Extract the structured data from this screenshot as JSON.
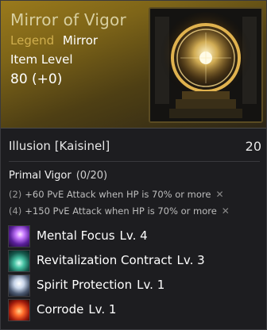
{
  "item": {
    "title": "Mirror of Vigor",
    "grade_label": "Legend",
    "grade_value": "Mirror",
    "item_level_label": "Item Level",
    "item_level_value": "80 (+0)",
    "image_icon": "mirror-portal-icon"
  },
  "illusion": {
    "name": "Illusion [Kaisinel]",
    "level": "20"
  },
  "set_bonus": {
    "name": "Primal Vigor",
    "count": "(0/20)",
    "effects": [
      {
        "req": "(2)",
        "text": "+60 PvE Attack when HP is 70% or more"
      },
      {
        "req": "(4)",
        "text": "+150 PvE Attack when HP is 70% or more"
      }
    ],
    "close_icon": "x-icon"
  },
  "skills": [
    {
      "name": "Mental Focus",
      "level": "Lv. 4",
      "icon": "mental-focus-icon"
    },
    {
      "name": "Revitalization Contract",
      "level": "Lv. 3",
      "icon": "revitalization-icon"
    },
    {
      "name": "Spirit Protection",
      "level": "Lv. 1",
      "icon": "spirit-protection-icon"
    },
    {
      "name": "Corrode",
      "level": "Lv. 1",
      "icon": "corrode-icon"
    }
  ],
  "colors": {
    "header_gold": "#9a7a1c",
    "grade_legend": "#cfae4e",
    "title": "#d8cfa0"
  }
}
